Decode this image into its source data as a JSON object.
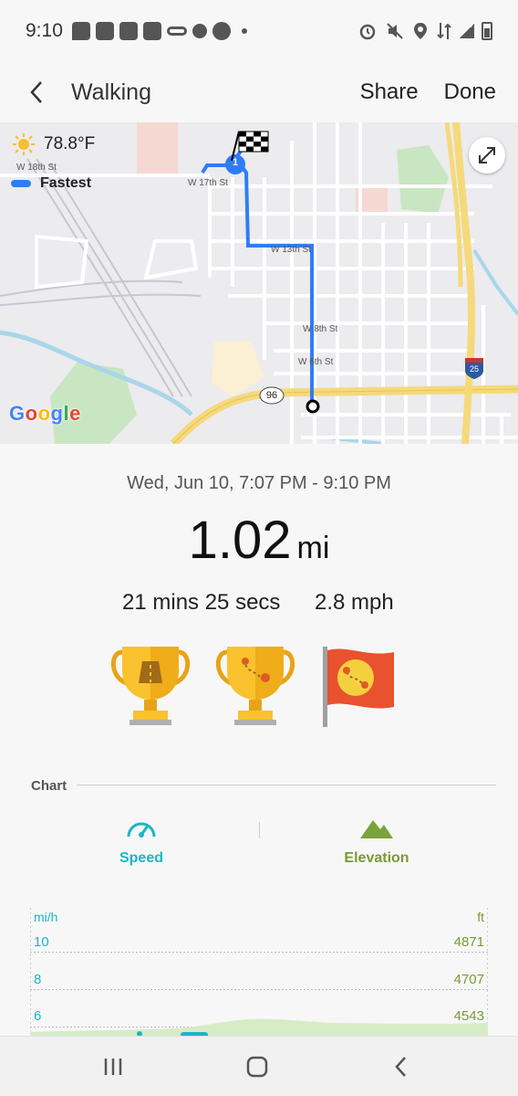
{
  "status_bar": {
    "time": "9:10"
  },
  "app_bar": {
    "title": "Walking",
    "share_label": "Share",
    "done_label": "Done"
  },
  "map": {
    "temperature": "78.8°F",
    "legend_label": "Fastest",
    "google_logo": [
      "G",
      "o",
      "o",
      "g",
      "l",
      "e"
    ],
    "streets": [
      "W 18th St",
      "W 17th St",
      "W 13th St",
      "W 8th St",
      "W 6th St"
    ],
    "route_badge": "1",
    "highway_shield": "96",
    "interstate_shield": "25"
  },
  "summary": {
    "date_range": "Wed, Jun 10, 7:07 PM - 9:10 PM",
    "distance_value": "1.02",
    "distance_unit": "mi",
    "duration": "21 mins 25 secs",
    "avg_speed": "2.8 mph"
  },
  "chart": {
    "section_label": "Chart",
    "tab_speed_label": "Speed",
    "tab_elevation_label": "Elevation",
    "left_unit": "mi/h",
    "right_unit": "ft",
    "left_ticks": [
      "10",
      "8",
      "6"
    ],
    "right_ticks": [
      "4871",
      "4707",
      "4543"
    ]
  },
  "colors": {
    "speed": "#1bb6c7",
    "elevation": "#7a9a33",
    "route": "#2f7df6"
  }
}
